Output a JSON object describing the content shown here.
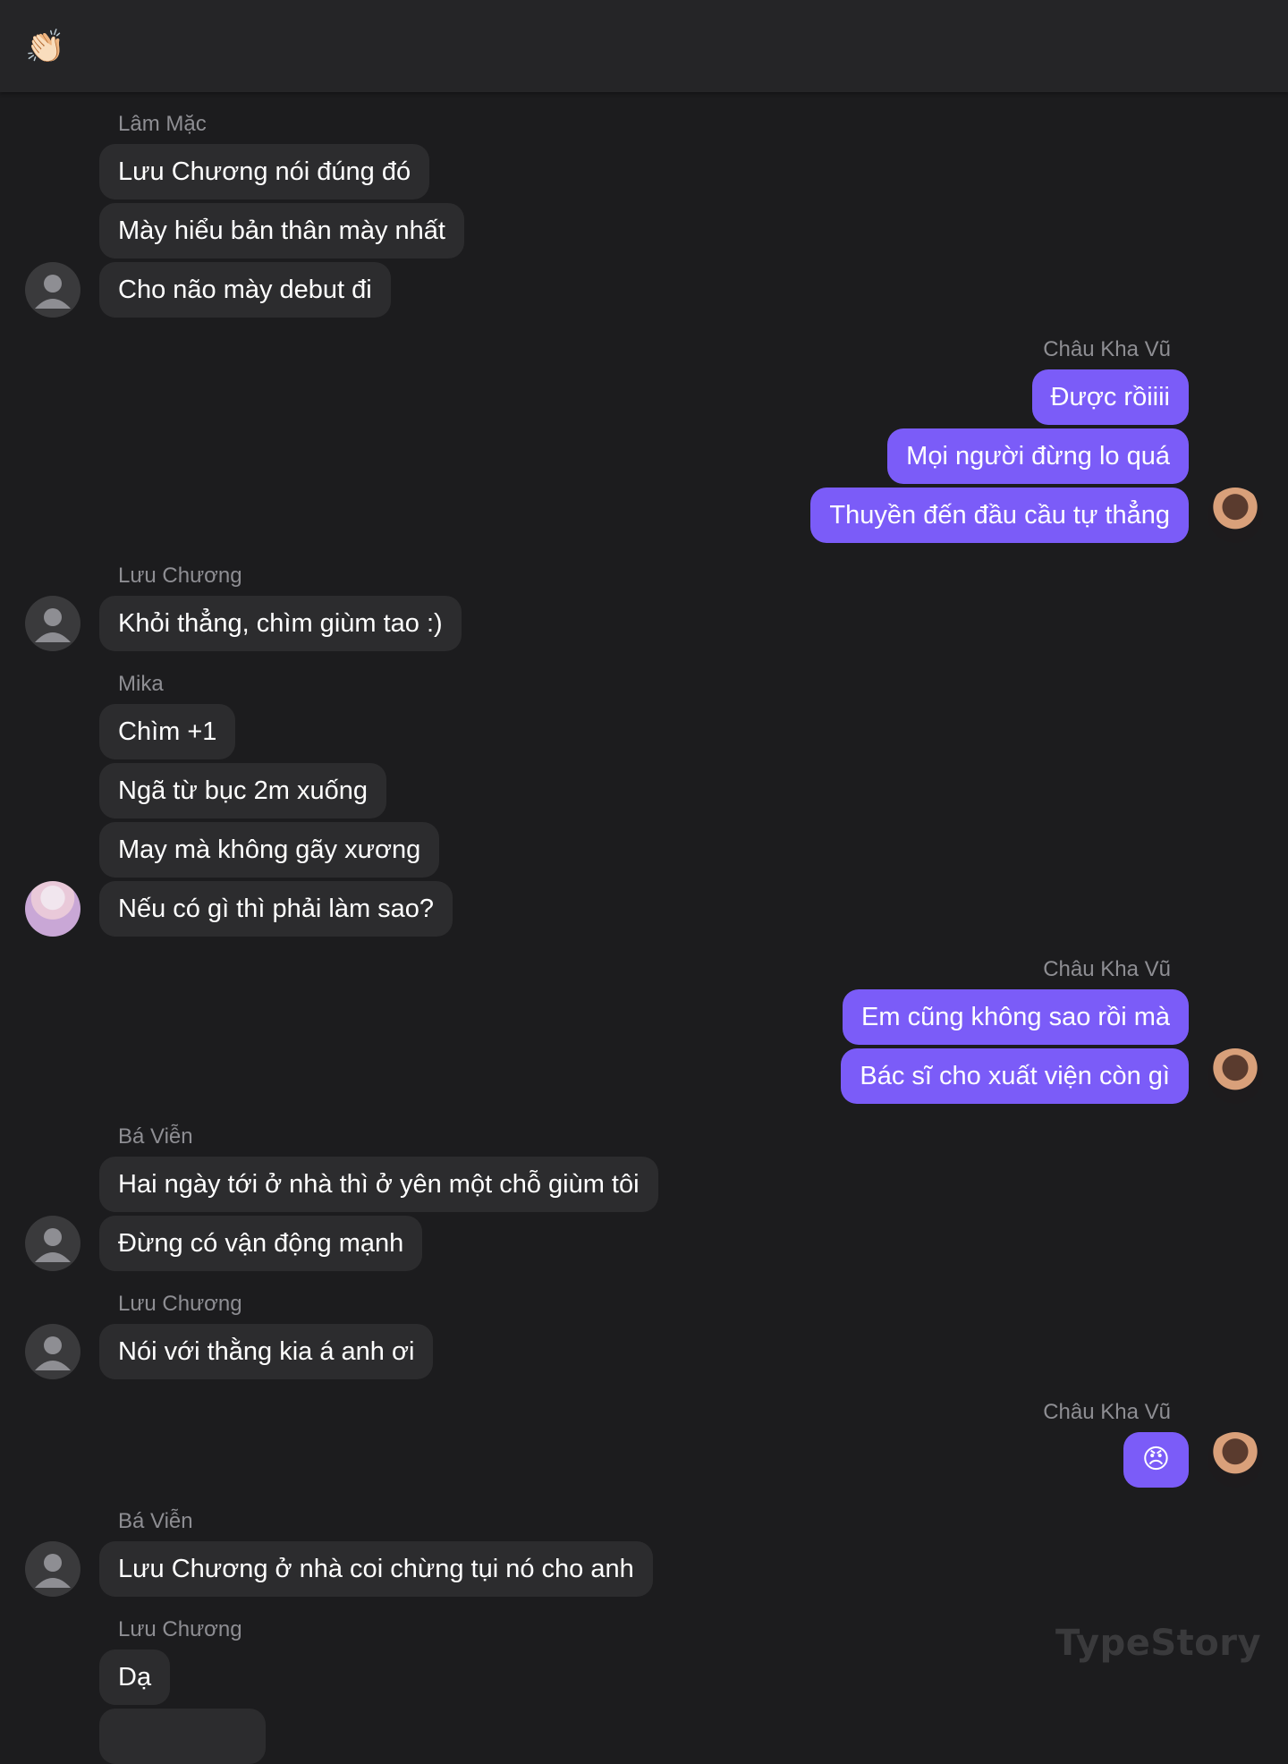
{
  "header": {
    "emoji": "👏🏻"
  },
  "watermark": "TypeStory",
  "messages": {
    "g1": {
      "sender": "Lâm Mặc",
      "m": [
        "Lưu Chương nói đúng đó",
        "Mày hiểu bản thân mày nhất",
        "Cho não mày debut đi"
      ]
    },
    "g2": {
      "sender": "Châu Kha Vũ",
      "m": [
        "Được rồiiii",
        "Mọi người đừng lo quá",
        "Thuyền đến đầu cầu tự thẳng"
      ]
    },
    "g3": {
      "sender": "Lưu Chương",
      "m": [
        "Khỏi thẳng, chìm giùm tao :)"
      ]
    },
    "g4": {
      "sender": "Mika",
      "m": [
        "Chìm +1",
        "Ngã từ bục 2m xuống",
        "May mà không gãy xương",
        "Nếu có gì thì phải làm sao?"
      ]
    },
    "g5": {
      "sender": "Châu Kha Vũ",
      "m": [
        "Em cũng không sao rồi mà",
        "Bác sĩ cho xuất viện còn gì"
      ]
    },
    "g6": {
      "sender": "Bá Viễn",
      "m": [
        "Hai ngày tới ở nhà thì ở yên một chỗ giùm tôi",
        "Đừng có vận động mạnh"
      ]
    },
    "g7": {
      "sender": "Lưu Chương",
      "m": [
        "Nói với thằng kia á anh ơi"
      ]
    },
    "g8": {
      "sender": "Châu Kha Vũ",
      "m": [
        "😠"
      ]
    },
    "g9": {
      "sender": "Bá Viễn",
      "m": [
        "Lưu Chương ở nhà coi chừng tụi nó cho anh"
      ]
    },
    "g10": {
      "sender": "Lưu Chương",
      "m": [
        "Dạ"
      ]
    }
  },
  "colors": {
    "incoming_bubble": "#2c2c2e",
    "outgoing_bubble": "#7b5cf8",
    "background": "#1c1c1e"
  }
}
